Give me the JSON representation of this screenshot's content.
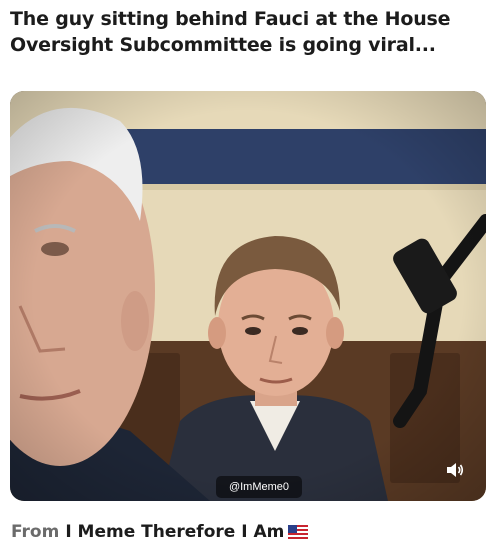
{
  "post": {
    "caption": "The guy sitting behind Fauci at the House Oversight Subcommittee is going viral..."
  },
  "video": {
    "watermark": "@ImMeme0",
    "audio_icon": "speaker-icon"
  },
  "source": {
    "from_label": "From",
    "name": "I Meme Therefore I Am",
    "flag_icon": "us-flag-icon"
  },
  "colors": {
    "text": "#1c1c1c",
    "muted": "#6b6b6b",
    "wall": "#e6d9b8",
    "stripe": "#2e4068",
    "wood": "#5a3a24"
  }
}
